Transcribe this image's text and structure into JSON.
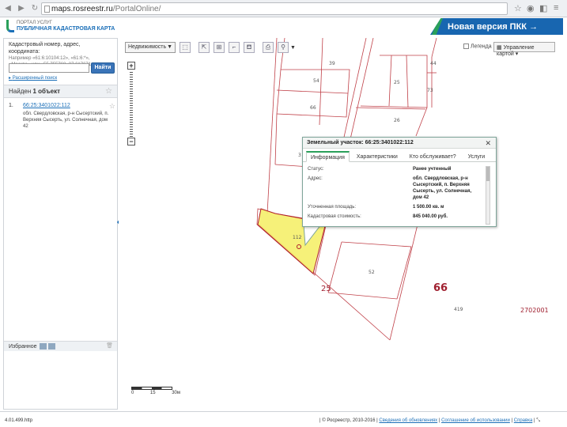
{
  "browser": {
    "url_host": "maps.rosreestr.ru",
    "url_path": "/PortalOnline/"
  },
  "header": {
    "logo_line1": "ПОРТАЛ УСЛУГ",
    "logo_line2": "ПУБЛИЧНАЯ КАДАСТРОВАЯ КАРТА",
    "new_version": "Новая версия ПКК →"
  },
  "sidebar": {
    "search_title": "Кадастровый номер, адрес, координата:",
    "search_hint": "Например «61:6:10104:12», «61:6:*», «Москва» или «55.755768, 37.617671»",
    "find_button": "Найти",
    "advanced_link": "Расширенный поиск",
    "found_prefix": "Найден ",
    "found_count": "1 объект",
    "result": {
      "num": "1.",
      "cadastral": "66:25:3401022:112",
      "address": "обл. Свердловская, р-н Сысертский, п. Верхняя Сысерть, ул. Солнечная, дом 42"
    },
    "favorites": "Избранное"
  },
  "toolbar": {
    "dropdown": "Недвижимость",
    "legend": "Легенда",
    "map_control": "Управление картой"
  },
  "map": {
    "labels": [
      "39",
      "44",
      "54",
      "25",
      "73",
      "66",
      "26",
      "3",
      "112",
      "52",
      "25",
      "66",
      "419",
      "2702001"
    ],
    "scale": [
      "0",
      "15",
      "30м"
    ]
  },
  "popup": {
    "title": "Земельный участок: 66:25:3401022:112",
    "tabs": [
      "Информация",
      "Характеристики",
      "Кто обслуживает?",
      "Услуги"
    ],
    "rows": [
      {
        "k": "Статус:",
        "v": "Ранее учтенный"
      },
      {
        "k": "Адрес:",
        "v": "обл. Свердловская, р-н Сысертский, п. Верхняя Сысерть, ул. Солнечная, дом 42"
      },
      {
        "k": "Уточненная площадь:",
        "v": "1 500.00 кв. м"
      },
      {
        "k": "Кадастровая стоимость:",
        "v": "845 040.00 руб."
      }
    ]
  },
  "status": {
    "version": "4.01.499.http",
    "copyright": "| © Росреестр, 2010-2016 |",
    "links": [
      "Сведения об обновлениях",
      "Соглашение об использовании",
      "Справка"
    ]
  },
  "colors": {
    "accent": "#1866b0",
    "green": "#2aa05a",
    "parcel_line": "#b0202a",
    "selected_fill": "#f5ef6a"
  }
}
